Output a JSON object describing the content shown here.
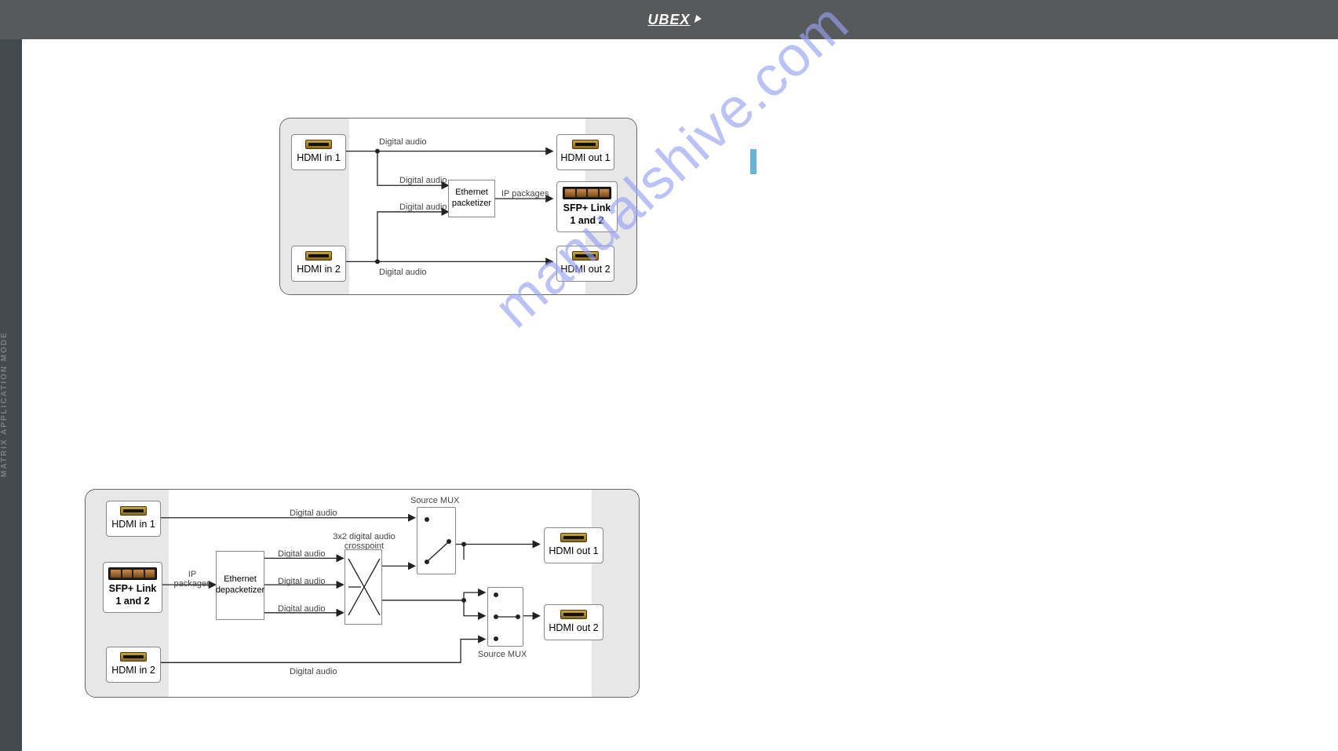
{
  "header": {
    "brand": "UBEX"
  },
  "sideTab": "MATRIX APPLICATION MODE",
  "watermark": "manualshive.com",
  "labels": {
    "digitalAudio": "Digital audio",
    "ipPackages": "IP packages"
  },
  "dia1": {
    "in1": "HDMI in 1",
    "in2": "HDMI in 2",
    "out1": "HDMI out 1",
    "out2": "HDMI out 2",
    "sfpTitle": "SFP+ Link",
    "sfpSub": "1 and 2",
    "packetizer": "Ethernet packetizer"
  },
  "dia2": {
    "in1": "HDMI in 1",
    "in2": "HDMI in 2",
    "out1": "HDMI out 1",
    "out2": "HDMI out 2",
    "sfpTitle": "SFP+ Link",
    "sfpSub": "1 and 2",
    "depacketizer": "Ethernet depacketizer",
    "crosspointLabel": "3x2 digital audio crosspoint",
    "sourceMux": "Source MUX"
  }
}
